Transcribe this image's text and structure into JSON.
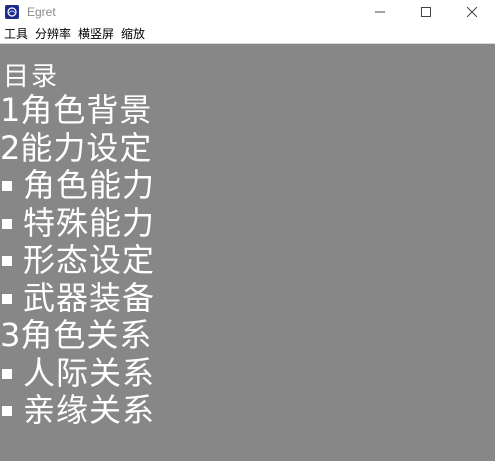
{
  "window": {
    "title": "Egret"
  },
  "menubar": {
    "items": [
      "工具",
      "分辨率",
      "横竖屏",
      "缩放"
    ]
  },
  "content": {
    "background": "#878787",
    "text_color": "#ffffff",
    "toc_title": "目录",
    "items": [
      {
        "marker": "1",
        "label": "角色背景",
        "type": "section"
      },
      {
        "marker": "2",
        "label": "能力设定",
        "type": "section"
      },
      {
        "marker": "",
        "label": "角色能力",
        "type": "bullet"
      },
      {
        "marker": "",
        "label": "特殊能力",
        "type": "bullet"
      },
      {
        "marker": "",
        "label": "形态设定",
        "type": "bullet"
      },
      {
        "marker": "",
        "label": "武器装备",
        "type": "bullet"
      },
      {
        "marker": "3",
        "label": "角色关系",
        "type": "section"
      },
      {
        "marker": "",
        "label": "人际关系",
        "type": "bullet"
      },
      {
        "marker": "",
        "label": "亲缘关系",
        "type": "bullet"
      }
    ]
  },
  "icons": {
    "app": "egret-app-icon",
    "minimize": "minimize-icon",
    "maximize": "maximize-icon",
    "close": "close-icon"
  }
}
